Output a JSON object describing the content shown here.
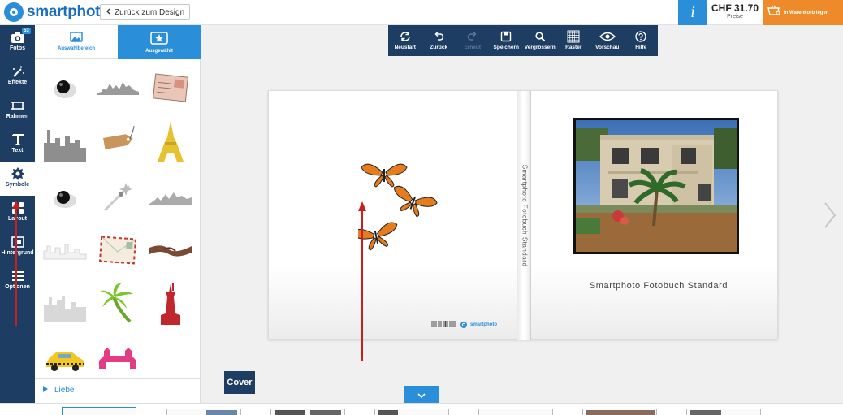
{
  "header": {
    "brand": "smartphoto",
    "back_label": "Zurück zum Design",
    "price": "CHF 31.70",
    "price_label": "Preise",
    "cart_label": "In Warenkorb legen"
  },
  "nav": {
    "badge": "53",
    "items": [
      {
        "label": "Fotos",
        "icon": "camera-icon"
      },
      {
        "label": "Effekte",
        "icon": "magic-wand-icon"
      },
      {
        "label": "Rahmen",
        "icon": "frame-icon"
      },
      {
        "label": "Text",
        "icon": "text-icon"
      },
      {
        "label": "Symbole",
        "icon": "symbol-gear-icon"
      },
      {
        "label": "Layout",
        "icon": "layout-icon"
      },
      {
        "label": "Hintergrund",
        "icon": "background-icon"
      },
      {
        "label": "Optionen",
        "icon": "options-list-icon"
      }
    ]
  },
  "panel": {
    "tab_a": "Auswahlbereich",
    "tab_b": "Ausgewählt",
    "category": "Liebe",
    "symbols": [
      "black-ball",
      "skyline-shadow",
      "postcard-stamp",
      "city-skyline",
      "tag-label",
      "eiffel-tower",
      "black-ball",
      "comet-sparkle",
      "skyline-grey",
      "skyline-white",
      "airmail-envelope",
      "holding-hands",
      "skyline-silhouette",
      "palm-tree",
      "statue-of-liberty",
      "taxi-car",
      "tower-bridge"
    ]
  },
  "toolbar": {
    "items": [
      {
        "label": "Neustart",
        "icon": "refresh-icon",
        "enabled": true
      },
      {
        "label": "Zurück",
        "icon": "undo-icon",
        "enabled": true
      },
      {
        "label": "Erneut",
        "icon": "redo-icon",
        "enabled": false
      },
      {
        "label": "Speichern",
        "icon": "save-icon",
        "enabled": true
      },
      {
        "label": "Vergrössern",
        "icon": "zoom-icon",
        "enabled": true
      },
      {
        "label": "Raster",
        "icon": "grid-icon",
        "enabled": true
      },
      {
        "label": "Vorschau",
        "icon": "eye-icon",
        "enabled": true
      },
      {
        "label": "Hilfe",
        "icon": "help-icon",
        "enabled": true
      }
    ]
  },
  "book": {
    "spine_text": "Smartphoto Fotobuch Standard",
    "title": "Smartphoto Fotobuch Standard",
    "back_brand": "smartphoto"
  },
  "page_label": "Cover",
  "colors": {
    "navy": "#1d3d63",
    "blue": "#2a8fd8",
    "orange": "#ef8a2a",
    "annotation_red": "#c8201e"
  }
}
